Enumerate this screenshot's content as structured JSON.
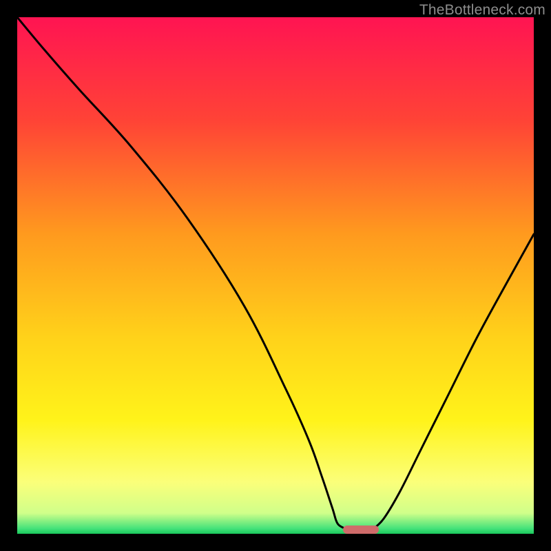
{
  "watermark": "TheBottleneck.com",
  "colors": {
    "frame_background": "#000000",
    "curve_stroke": "#000000",
    "marker_fill": "#cf6b6a",
    "watermark_text": "#8d8d8d"
  },
  "chart_data": {
    "type": "line",
    "title": "",
    "xlabel": "",
    "ylabel": "",
    "xlim": [
      0,
      100
    ],
    "ylim": [
      0,
      100
    ],
    "gradient": [
      {
        "stop": 0,
        "color": "#ff1452"
      },
      {
        "stop": 20,
        "color": "#ff4336"
      },
      {
        "stop": 42,
        "color": "#ff9a1e"
      },
      {
        "stop": 62,
        "color": "#ffd21a"
      },
      {
        "stop": 78,
        "color": "#fff31a"
      },
      {
        "stop": 90,
        "color": "#fbff7a"
      },
      {
        "stop": 96,
        "color": "#d0ff8a"
      },
      {
        "stop": 99,
        "color": "#44e27a"
      },
      {
        "stop": 100,
        "color": "#19c85c"
      }
    ],
    "series": [
      {
        "name": "left-curve",
        "x": [
          0,
          5,
          12,
          22,
          33,
          44,
          52,
          56.5,
          59,
          61,
          62,
          63.5
        ],
        "values": [
          100,
          94,
          86,
          75,
          61,
          44,
          28,
          18,
          11,
          5,
          2,
          1.0
        ]
      },
      {
        "name": "right-curve",
        "x": [
          69,
          71,
          74,
          78,
          83,
          89,
          95,
          100
        ],
        "values": [
          1.0,
          3,
          8,
          16,
          26,
          38,
          49,
          58
        ]
      }
    ],
    "marker": {
      "x_start": 63,
      "x_end": 70,
      "y": 0.8
    },
    "note": "Values are percentages of plot width/height; y=100 is top, y=0 is bottom."
  }
}
